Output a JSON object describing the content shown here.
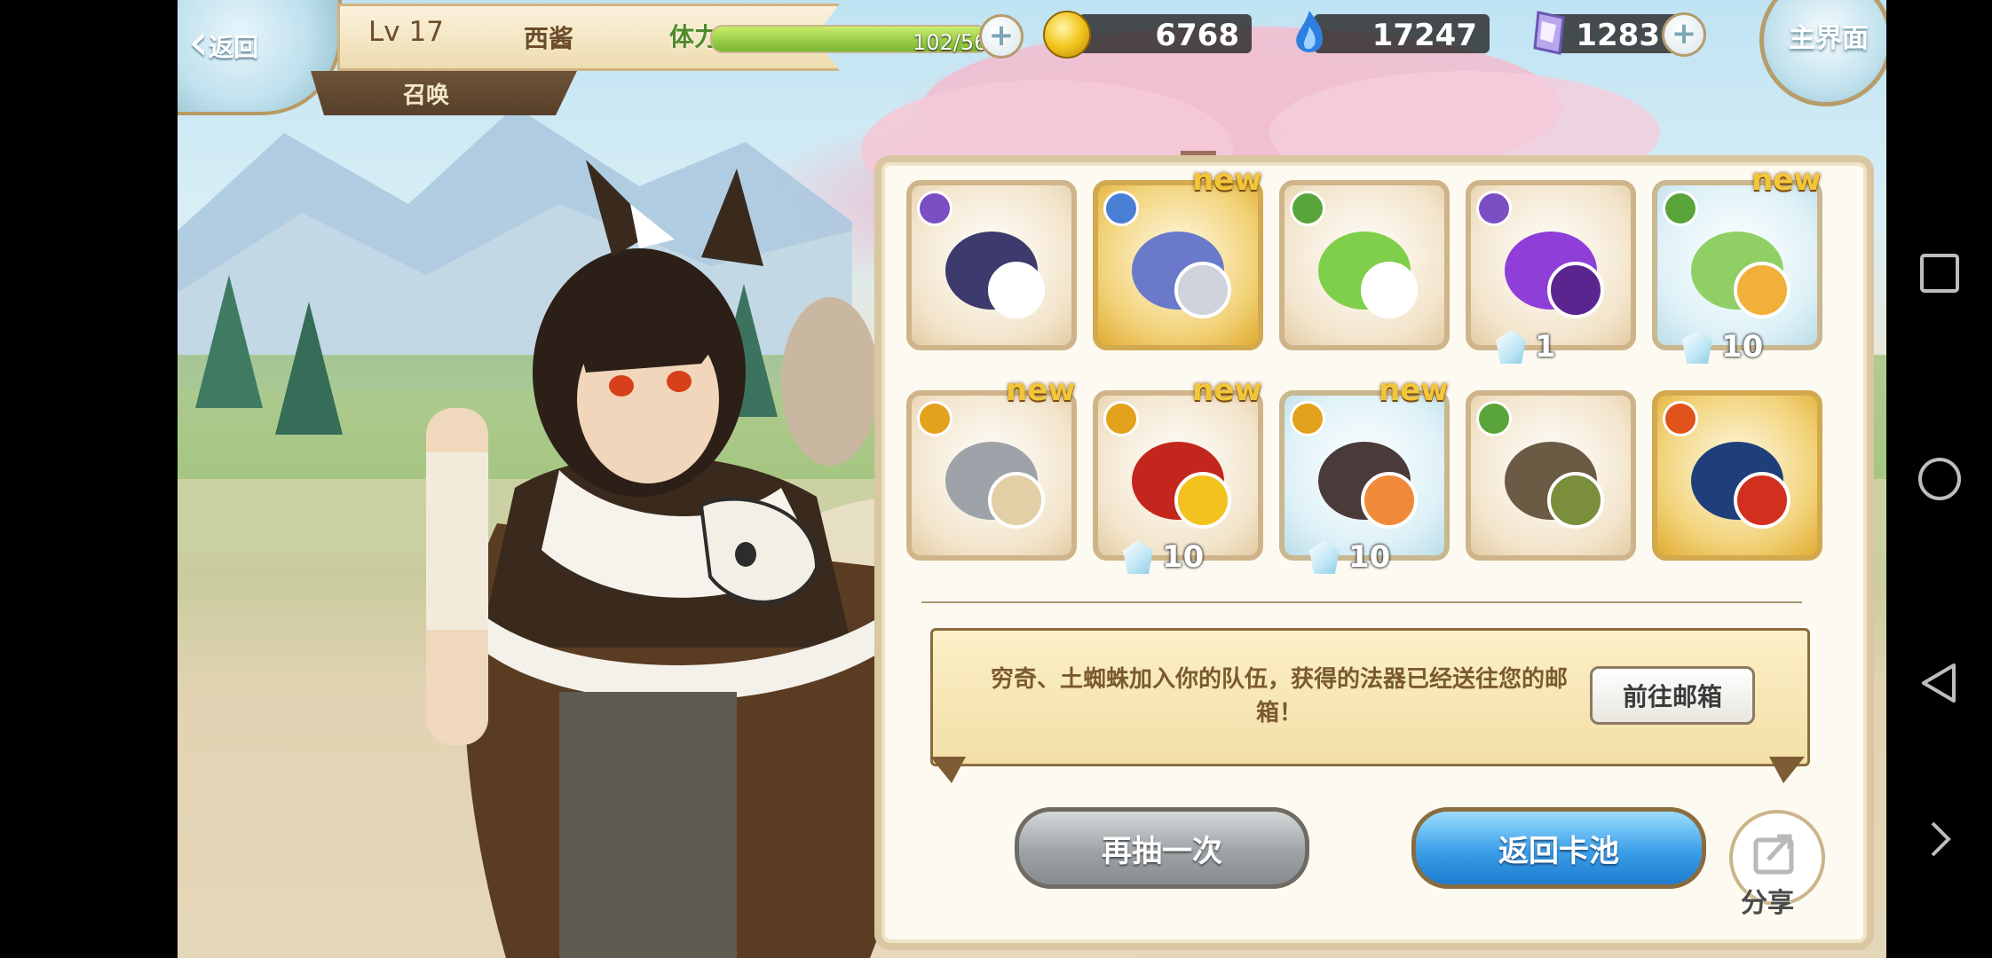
{
  "hud": {
    "back_label": "返回",
    "level": "Lv 17",
    "player_name": "西酱",
    "screen_tag": "召唤",
    "stamina_label": "体力",
    "stamina_text": "102/56",
    "stamina_fill_fraction": 1.0,
    "gold": "6768",
    "soul": "17247",
    "crystal": "1283",
    "home_label": "主界面"
  },
  "items": [
    {
      "element_color": "#7b4fc4",
      "new": false,
      "qty": "",
      "icon": "hero-dark-haired-glasses-icon",
      "rare": false
    },
    {
      "element_color": "#4a7fd6",
      "new": true,
      "qty": "",
      "icon": "sword-blue-cloud-icon",
      "rare": true
    },
    {
      "element_color": "#5aa53a",
      "new": false,
      "qty": "",
      "icon": "hero-green-hair-icon",
      "rare": false
    },
    {
      "element_color": "#7b4fc4",
      "new": false,
      "qty": "1",
      "icon": "purple-gourd-icon",
      "rare": false
    },
    {
      "element_color": "#5aa53a",
      "new": true,
      "qty": "10",
      "icon": "leaf-earring-icon",
      "rare": false
    },
    {
      "element_color": "#e2a21c",
      "new": true,
      "qty": "",
      "icon": "dagger-icon",
      "rare": false
    },
    {
      "element_color": "#e2a21c",
      "new": true,
      "qty": "10",
      "icon": "red-amulet-icon",
      "rare": false
    },
    {
      "element_color": "#e2a21c",
      "new": true,
      "qty": "10",
      "icon": "winged-ring-icon",
      "rare": false
    },
    {
      "element_color": "#5aa53a",
      "new": false,
      "qty": "",
      "icon": "hero-brown-hair-rake-icon",
      "rare": false
    },
    {
      "element_color": "#e0531b",
      "new": false,
      "qty": "",
      "icon": "hero-white-hair-banner-icon",
      "rare": true
    }
  ],
  "new_label": "new",
  "message": "穷奇、土蜘蛛加入你的队伍，获得的法器已经送往您的邮箱！",
  "mail_button": "前往邮箱",
  "draw_again": "再抽一次",
  "back_to_pool": "返回卡池",
  "share_label": "分享"
}
